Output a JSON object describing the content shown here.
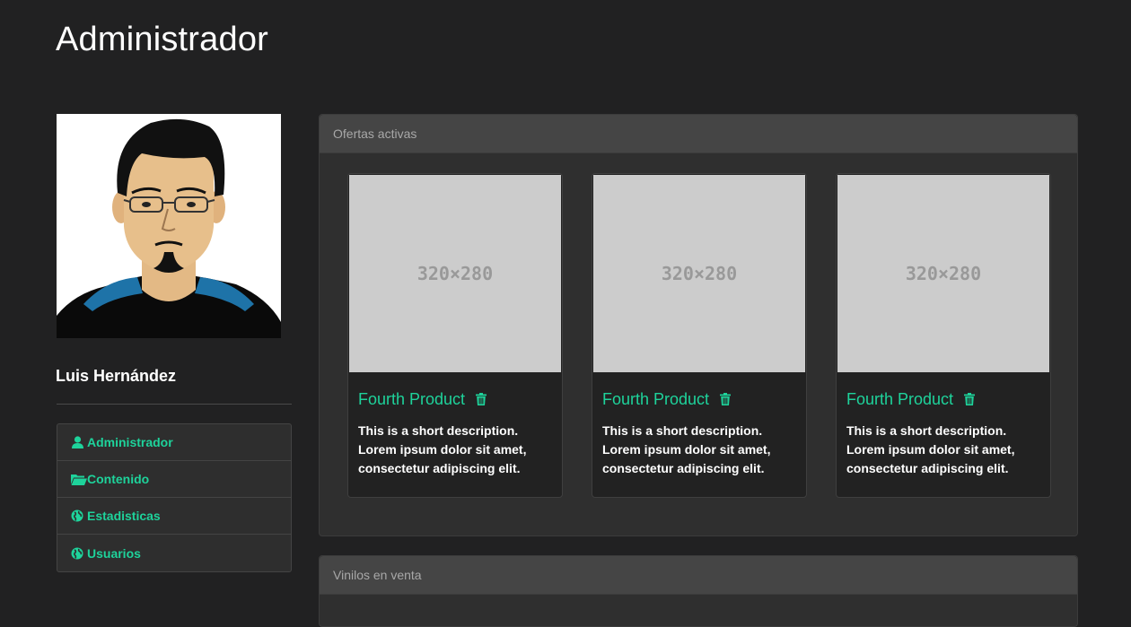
{
  "header": {
    "title": "Administrador"
  },
  "profile": {
    "name": "Luis Hernández",
    "avatar_icon": "user-avatar-illustration"
  },
  "sidebar": {
    "items": [
      {
        "label": "Administrador",
        "icon": "user-icon"
      },
      {
        "label": "Contenido",
        "icon": "folder-open-icon"
      },
      {
        "label": "Estadisticas",
        "icon": "globe-icon"
      },
      {
        "label": "Usuarios",
        "icon": "globe-icon"
      }
    ]
  },
  "offers_panel": {
    "heading": "Ofertas activas",
    "products": [
      {
        "image_placeholder": "320×280",
        "title": "Fourth Product",
        "description": "This is a short description. Lorem ipsum dolor sit amet, consectetur adipiscing elit."
      },
      {
        "image_placeholder": "320×280",
        "title": "Fourth Product",
        "description": "This is a short description. Lorem ipsum dolor sit amet, consectetur adipiscing elit."
      },
      {
        "image_placeholder": "320×280",
        "title": "Fourth Product",
        "description": "This is a short description. Lorem ipsum dolor sit amet, consectetur adipiscing elit."
      }
    ]
  },
  "vinyl_panel": {
    "heading": "Vinilos en venta"
  },
  "colors": {
    "background": "#212122",
    "accent": "#1ed39b",
    "panel": "#2f2f2f",
    "panel_heading": "#454545"
  }
}
